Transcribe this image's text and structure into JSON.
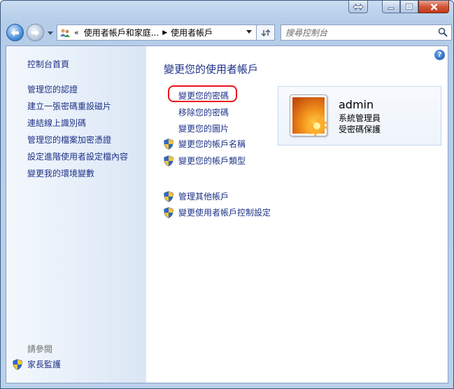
{
  "address": {
    "overflow": "«",
    "crumbs": [
      "使用者帳戶和家庭...",
      "使用者帳戶"
    ]
  },
  "search": {
    "placeholder": "搜尋控制台"
  },
  "sidebar": {
    "items": [
      {
        "label": "控制台首頁"
      },
      {
        "label": "管理您的認證"
      },
      {
        "label": "建立一張密碼重設磁片"
      },
      {
        "label": "連結線上識別碼"
      },
      {
        "label": "管理您的檔案加密憑證"
      },
      {
        "label": "設定進階使用者設定檔內容"
      },
      {
        "label": "變更我的環境變數"
      }
    ],
    "see_also": "請參閱",
    "parental": "家長監護"
  },
  "main": {
    "heading": "變更您的使用者帳戶",
    "tasks": [
      {
        "label": "變更您的密碼"
      },
      {
        "label": "移除您的密碼"
      },
      {
        "label": "變更您的圖片"
      },
      {
        "label": "變更您的帳戶名稱"
      },
      {
        "label": "變更您的帳戶類型"
      },
      {
        "label": "管理其他帳戶"
      },
      {
        "label": "變更使用者帳戶控制設定"
      }
    ],
    "help": "?"
  },
  "account": {
    "name": "admin",
    "role": "系統管理員",
    "protection": "受密碼保護"
  },
  "colors": {
    "link": "#1e3287",
    "highlight": "#e8141c"
  },
  "icons": [
    "restore-icon",
    "minimize-icon",
    "maximize-icon",
    "close-icon",
    "back-arrow-icon",
    "forward-arrow-icon",
    "users-folder-icon",
    "refresh-icon",
    "search-icon",
    "help-icon",
    "uac-shield-icon",
    "flower-avatar"
  ]
}
